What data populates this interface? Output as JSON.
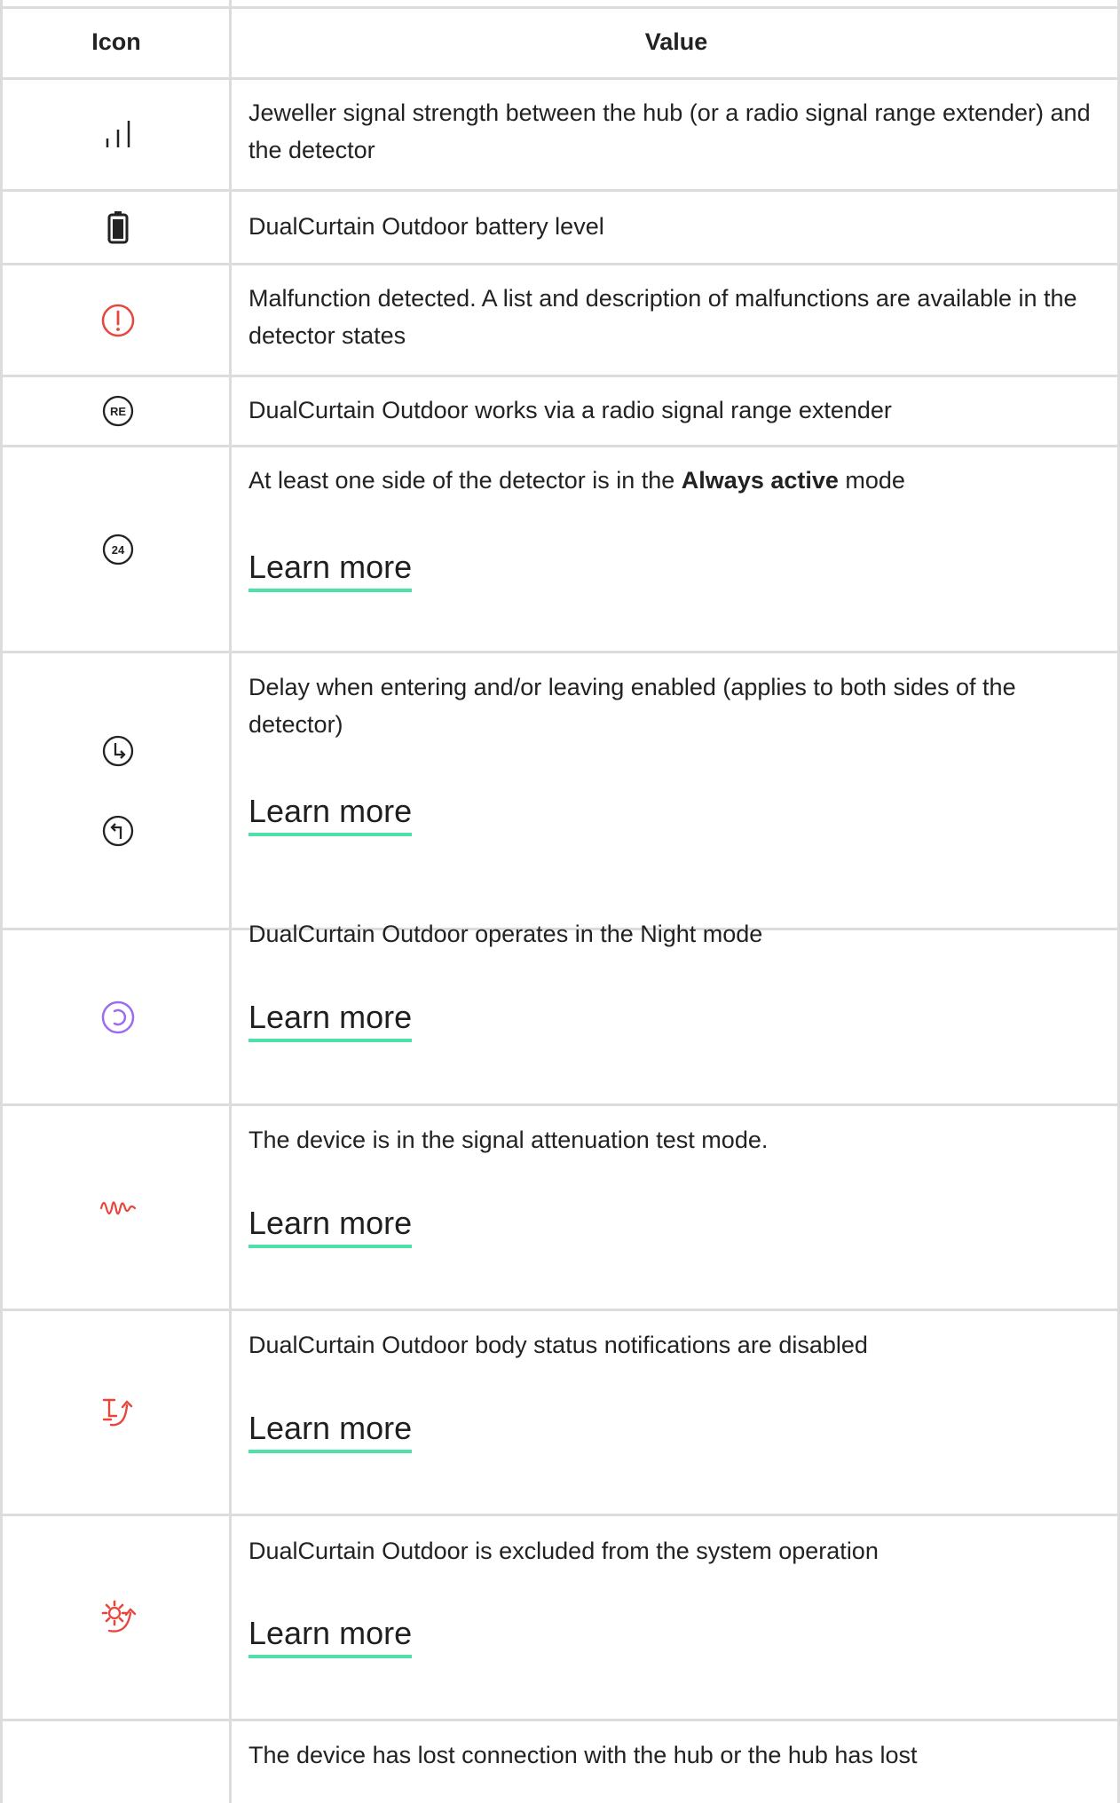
{
  "header": {
    "icon_col": "Icon",
    "value_col": "Value"
  },
  "rows": [
    {
      "icon": "signal-strength-icon",
      "text": "Jeweller signal strength between the hub (or a radio signal range extender) and the detector"
    },
    {
      "icon": "battery-icon",
      "text": "DualCurtain Outdoor battery level"
    },
    {
      "icon": "malfunction-icon",
      "text": "Malfunction detected. A list and description of malfunctions are available in the detector states"
    },
    {
      "icon": "range-extender-icon",
      "text": "DualCurtain Outdoor works via a radio signal range extender"
    },
    {
      "icon": "always-active-icon",
      "text_pre": "At least one side of the detector is in the ",
      "text_bold": "Always active",
      "text_post": " mode",
      "link": "Learn more"
    },
    {
      "icon": "delay-icon",
      "text": "Delay when entering and/or leaving enabled (applies to both sides of the detector)",
      "link": "Learn more"
    },
    {
      "icon": "night-mode-icon",
      "text": "DualCurtain Outdoor operates in the Night mode",
      "link": "Learn more"
    },
    {
      "icon": "attenuation-test-icon",
      "text": "The device is in the signal attenuation test mode.",
      "link": "Learn more"
    },
    {
      "icon": "body-status-disabled-icon",
      "text": "DualCurtain Outdoor body status notifications are disabled",
      "link": "Learn more"
    },
    {
      "icon": "excluded-icon",
      "text": "DualCurtain Outdoor is excluded from the system operation",
      "link": "Learn more"
    },
    {
      "icon": "connection-lost-icon",
      "text": "The device has lost connection with the hub or the hub has lost"
    }
  ],
  "icon_label_re": "RE",
  "icon_label_24": "24",
  "colors": {
    "red": "#e8463c",
    "purple": "#9b6cf2",
    "accent_underline": "#4fe0a8",
    "border": "#dcdcdc"
  }
}
